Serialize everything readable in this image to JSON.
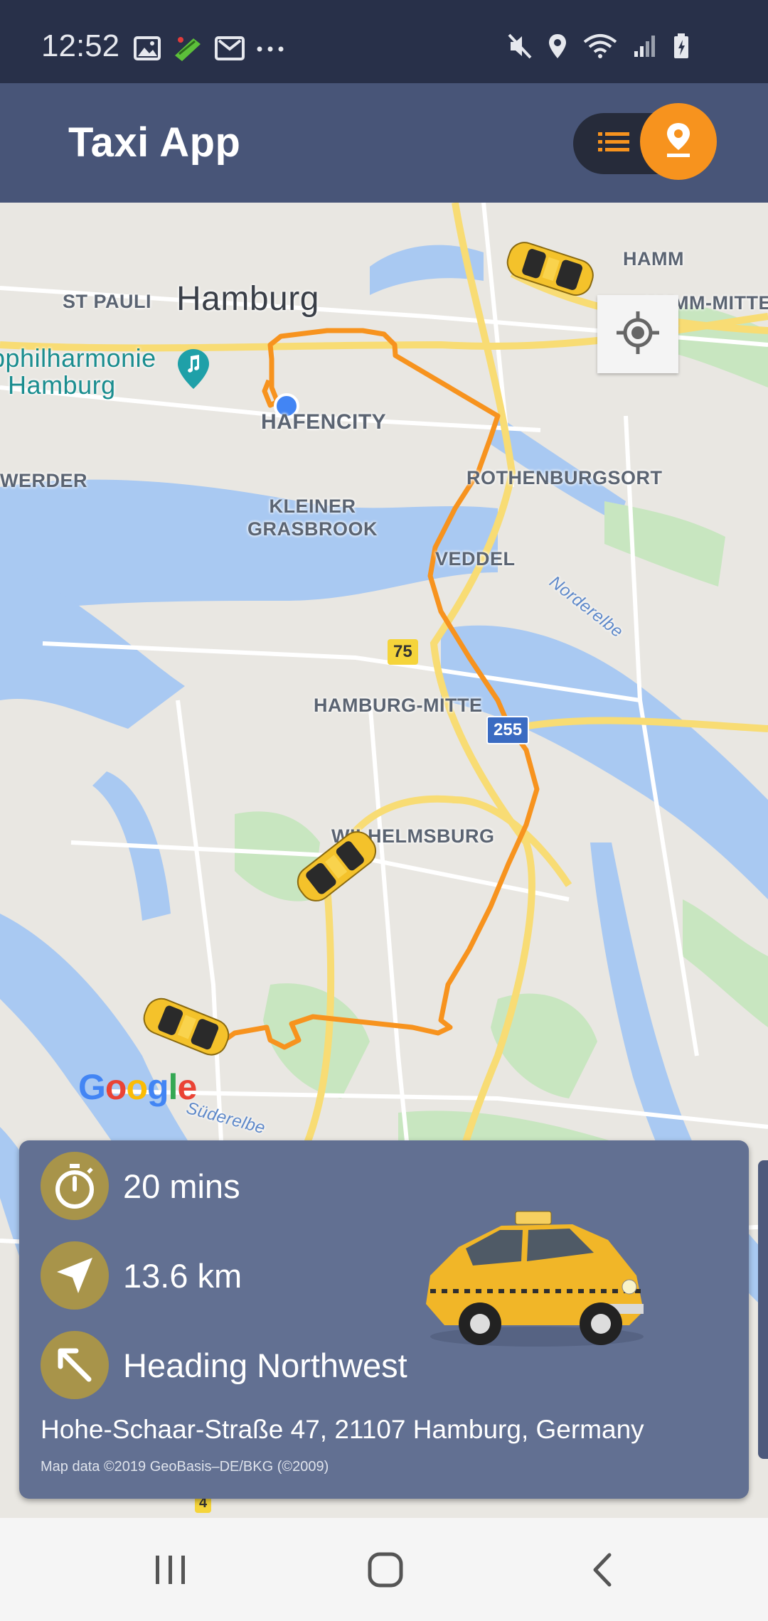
{
  "status_bar": {
    "time": "12:52",
    "left_icons": [
      "image-icon",
      "app-icon",
      "gmail-icon",
      "more-dots-icon"
    ],
    "right_icons": [
      "mute-icon",
      "location-icon",
      "wifi-icon",
      "signal-icon",
      "battery-icon"
    ]
  },
  "app_bar": {
    "title": "Taxi App",
    "toggle": {
      "list_icon": "list-icon",
      "map_icon": "map-pin-icon",
      "active": "map"
    }
  },
  "map": {
    "labels": {
      "hamburg": "Hamburg",
      "st_pauli": "ST PAULI",
      "elbphilharmonie": "Elbphilharmonie\nHamburg",
      "hafencity": "HAFENCITY",
      "hamm": "HAMM",
      "hamm_mitte": "HAMM-MITTE",
      "rothenburgsort": "ROTHENBURGSORT",
      "werder": "WERDER",
      "kleiner_grasbrook": "KLEINER\nGRASBROOK",
      "veddel": "VEDDEL",
      "norderelbe": "Norderelbe",
      "hamburg_mitte": "HAMBURG-MITTE",
      "wilhelmsburg": "WILHELMSBURG",
      "suederelbe": "Süderelbe"
    },
    "shields": {
      "b75": "75",
      "b255": "255",
      "b4": "4"
    },
    "google_logo": "Google",
    "colors": {
      "route": "#f7931e",
      "water": "#a9c9f2",
      "park": "#c8e6c0",
      "land": "#e9e7e2",
      "road_major": "#f8dc74"
    }
  },
  "trip_info": {
    "duration": "20 mins",
    "distance": "13.6 km",
    "heading": "Heading Northwest",
    "address": "Hohe-Schaar-Straße 47, 21107 Hamburg, Germany",
    "attribution": "Map data ©2019 GeoBasis–DE/BKG (©2009)",
    "icons": [
      "stopwatch-icon",
      "navigation-arrow-icon",
      "arrow-northwest-icon"
    ],
    "accent_color": "#a8944a"
  },
  "nav_bar": {
    "buttons": [
      "recent-apps-icon",
      "home-icon",
      "back-icon"
    ]
  }
}
